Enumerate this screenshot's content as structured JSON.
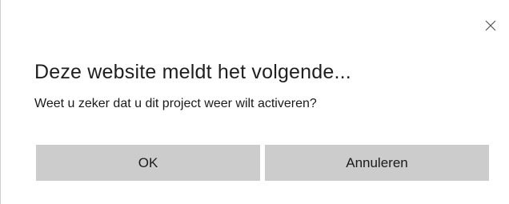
{
  "dialog": {
    "close_icon": "close-icon",
    "title": "Deze website meldt het volgende...",
    "message": "Weet u zeker dat u dit project weer wilt activeren?",
    "ok_label": "OK",
    "cancel_label": "Annuleren"
  },
  "colors": {
    "button_bg": "#cccccc",
    "text": "#1a1a1a",
    "background": "#ffffff"
  }
}
